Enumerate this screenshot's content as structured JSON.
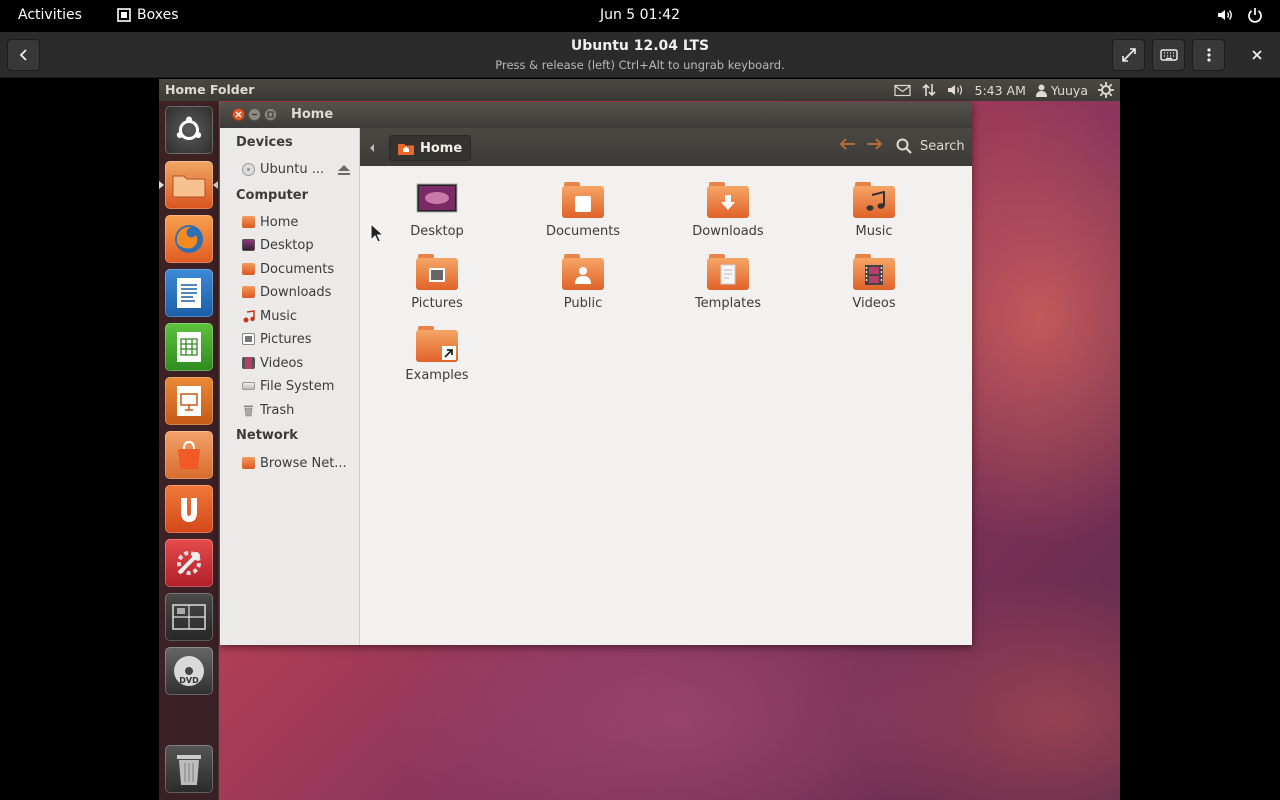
{
  "gnome_topbar": {
    "activities": "Activities",
    "app_name": "Boxes",
    "clock": "Jun 5  01:42"
  },
  "boxes_header": {
    "title": "Ubuntu 12.04 LTS",
    "subtitle": "Press & release (left) Ctrl+Alt to ungrab keyboard."
  },
  "ubuntu_panel": {
    "window_title": "Home Folder",
    "time": "5:43 AM",
    "user": "Yuuya"
  },
  "nautilus": {
    "title": "Home",
    "breadcrumb": "Home",
    "search_label": "Search",
    "sidebar": {
      "devices_heading": "Devices",
      "devices": [
        "Ubuntu ..."
      ],
      "computer_heading": "Computer",
      "computer": [
        "Home",
        "Desktop",
        "Documents",
        "Downloads",
        "Music",
        "Pictures",
        "Videos",
        "File System",
        "Trash"
      ],
      "network_heading": "Network",
      "network": [
        "Browse Net..."
      ]
    },
    "items": [
      "Desktop",
      "Documents",
      "Downloads",
      "Music",
      "Pictures",
      "Public",
      "Templates",
      "Videos",
      "Examples"
    ]
  },
  "colors": {
    "ubuntu_orange": "#e0632a",
    "close_button": "#e05a2b",
    "panel_bg": "#3c3b37"
  }
}
